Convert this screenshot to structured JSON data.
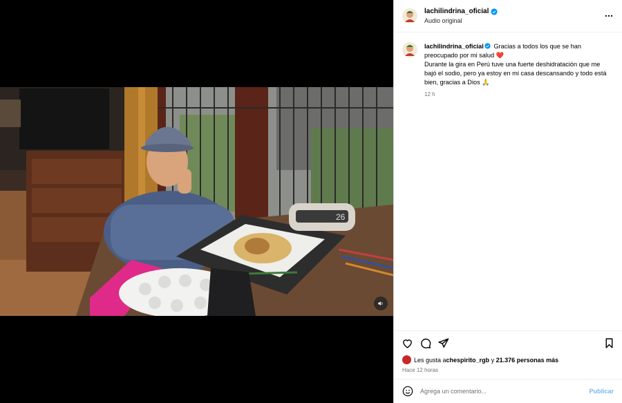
{
  "post": {
    "username": "lachilindrina_oficial",
    "audio_label": "Audio original",
    "caption": {
      "line1": "Gracias a todos los que se han preocupado por mi salud ",
      "heart": "❤️",
      "line2": "Durante la gira en Perú tuve una fuerte deshidratación que me bajó el sodio, pero ya estoy en mi casa descansando y todo está bien, gracias a Dios ",
      "pray": "🙏",
      "time": "12 h"
    },
    "likes": {
      "prefix": "Les gusta a ",
      "user": "chespirito_rgb",
      "middle": " y ",
      "count": "21.376 personas más"
    },
    "posted_ago": "Hace 12 horas",
    "comment": {
      "placeholder": "Agrega un comentario...",
      "submit_label": "Publicar"
    }
  },
  "icons": {
    "verified": "verified-badge-icon",
    "more": "more-options-icon",
    "like": "heart-icon",
    "comment": "comment-icon",
    "share": "paper-plane-icon",
    "save": "bookmark-icon",
    "emoji": "emoji-icon",
    "mute": "speaker-icon"
  },
  "colors": {
    "verified": "#0095f6",
    "publish": "#7bb8f0",
    "heart": "#ed4956"
  }
}
